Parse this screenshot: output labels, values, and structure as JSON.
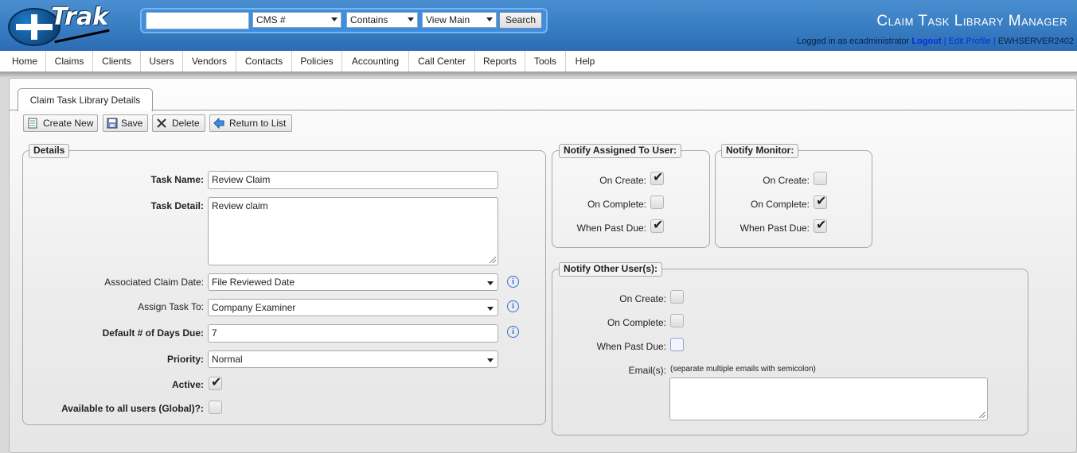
{
  "header": {
    "logo_text": "Trak",
    "app_title": "Claim Task Library Manager",
    "search": {
      "query": "",
      "field_select": "CMS #",
      "operator_select": "Contains",
      "view_select": "View Main",
      "button_label": "Search"
    },
    "login": {
      "prefix": "Logged in as ecadministrator",
      "logout": "Logout",
      "sep1": "|",
      "edit_profile": "Edit Profile",
      "sep2": "|",
      "server": "EWHSERVER2402"
    },
    "colors": {
      "header_blue": "#2a6db5",
      "link_blue": "#0b2bdc"
    }
  },
  "nav": {
    "items": [
      "Home",
      "Claims",
      "Clients",
      "Users",
      "Vendors",
      "Contacts",
      "Policies",
      "Accounting",
      "Call Center",
      "Reports",
      "Tools",
      "Help"
    ]
  },
  "tab": {
    "label": "Claim Task Library Details"
  },
  "toolbar": {
    "create_new": "Create New",
    "save": "Save",
    "delete": "Delete",
    "return_to_list": "Return to List"
  },
  "details": {
    "legend": "Details",
    "task_name_label": "Task Name:",
    "task_name_value": "Review Claim",
    "task_detail_label": "Task Detail:",
    "task_detail_value": "Review claim",
    "assoc_date_label": "Associated Claim Date:",
    "assoc_date_value": "File Reviewed Date",
    "assign_to_label": "Assign Task To:",
    "assign_to_value": "Company Examiner",
    "days_due_label": "Default # of Days Due:",
    "days_due_value": "7",
    "priority_label": "Priority:",
    "priority_value": "Normal",
    "active_label": "Active:",
    "active_checked": true,
    "global_label": "Available to all users (Global)?:",
    "global_checked": false,
    "info_glyph": "i"
  },
  "notify_assigned": {
    "legend": "Notify Assigned To User:",
    "on_create_label": "On Create:",
    "on_create": true,
    "on_complete_label": "On Complete:",
    "on_complete": false,
    "past_due_label": "When Past Due:",
    "past_due": true
  },
  "notify_monitor": {
    "legend": "Notify Monitor:",
    "on_create_label": "On Create:",
    "on_create": false,
    "on_complete_label": "On Complete:",
    "on_complete": true,
    "past_due_label": "When Past Due:",
    "past_due": true
  },
  "notify_other": {
    "legend": "Notify Other User(s):",
    "on_create_label": "On Create:",
    "on_create": false,
    "on_complete_label": "On Complete:",
    "on_complete": false,
    "past_due_label": "When Past Due:",
    "past_due": false,
    "emails_label": "Email(s):",
    "emails_hint": "(separate multiple emails with semicolon)",
    "emails_value": ""
  },
  "check_glyph": "✔"
}
